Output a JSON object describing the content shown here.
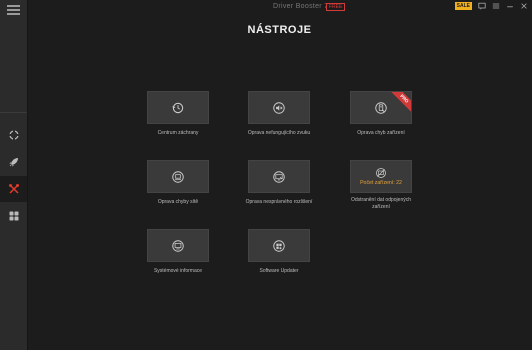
{
  "app": {
    "title": "Driver Booster 7",
    "free_badge": "FREE",
    "sale_badge": "SALE"
  },
  "page": {
    "title": "NÁSTROJE"
  },
  "tiles": [
    {
      "label": "Centrum záchrany"
    },
    {
      "label": "Oprava nefungujícího zvuku"
    },
    {
      "label": "Oprava chyb zařízení",
      "badge": "PRO"
    },
    {
      "label": "Oprava chyby sítě"
    },
    {
      "label": "Oprava nesprávného rozlišení"
    },
    {
      "label": "Odstranění dat odpojených zařízení",
      "count_text": "Počet zařízení: 22"
    },
    {
      "label": "Systémové informace"
    },
    {
      "label": "Software Updater"
    }
  ],
  "sidebar": {
    "items": [
      {
        "name": "scan",
        "icon": "refresh-icon"
      },
      {
        "name": "boost",
        "icon": "rocket-icon"
      },
      {
        "name": "tools",
        "icon": "tools-icon",
        "active": true
      },
      {
        "name": "action-center",
        "icon": "grid-icon"
      }
    ]
  },
  "colors": {
    "accent": "#e8a33a",
    "active_icon": "#e03a2a",
    "badge_red": "#d23a3a"
  }
}
